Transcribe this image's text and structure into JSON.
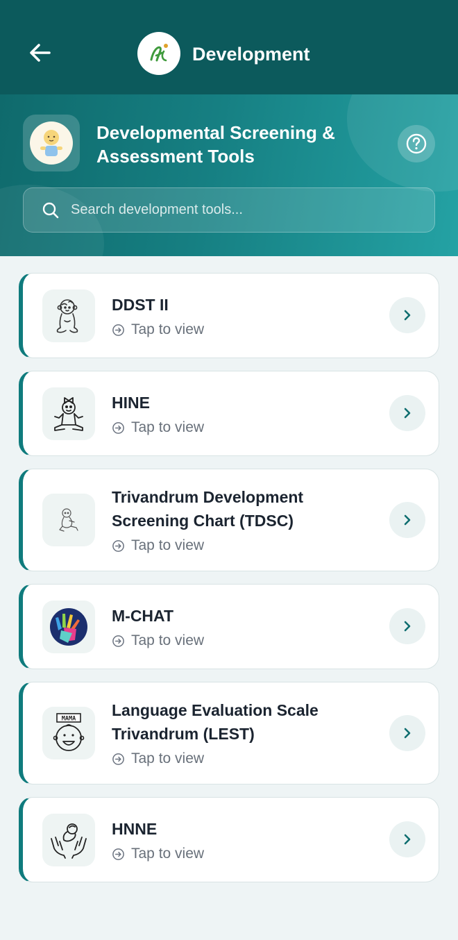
{
  "header": {
    "title": "Development",
    "back_icon": "arrow-left-icon",
    "logo_icon": "app-logo-icon"
  },
  "hero": {
    "title": "Developmental Screening & Assessment Tools",
    "icon": "baby-icon",
    "help_icon": "question-circle-icon"
  },
  "search": {
    "placeholder": "Search development tools..."
  },
  "tools": [
    {
      "title": "DDST II",
      "subtitle": "Tap to view",
      "icon": "sitting-baby-icon"
    },
    {
      "title": "HINE",
      "subtitle": "Tap to view",
      "icon": "baby-girl-icon"
    },
    {
      "title": "Trivandrum Development Screening Chart (TDSC)",
      "subtitle": "Tap to view",
      "icon": "crawling-baby-icon"
    },
    {
      "title": "M-CHAT",
      "subtitle": "Tap to view",
      "icon": "autism-hands-icon"
    },
    {
      "title": "Language Evaluation Scale Trivandrum (LEST)",
      "subtitle": "Tap to view",
      "icon": "mama-baby-icon"
    },
    {
      "title": "HNNE",
      "subtitle": "Tap to view",
      "icon": "newborn-hands-icon"
    }
  ],
  "colors": {
    "header_bg": "#0c5a5c",
    "accent": "#0f7b7d",
    "hero_gradient_end": "#24a2a4"
  }
}
